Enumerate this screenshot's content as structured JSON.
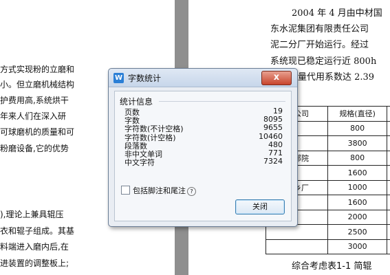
{
  "left_page": {
    "lines": [
      "方式实现粉的立磨和",
      "小。但立磨机械结构",
      "护费用高,系统烘干",
      "年来人们在深入研",
      "可球磨机的质量和可",
      "粉磨设备,它的优势",
      "),理论上兼具辊压",
      "衣和辊子组成。其基",
      "料端进入磨内后,在",
      "进装置的调整板上;"
    ]
  },
  "right_page": {
    "lines": [
      "2004 年 4 月由中材国",
      "东水泥集团有限责任公司",
      "泥二分厂开始运行。经过",
      "系统现已稳定运行近 800h",
      "能量代用系数达 2.39"
    ],
    "caption": "综合考虑表1-1 简辊"
  },
  "table": {
    "headers": [
      "公司",
      "规格(直径)"
    ],
    "rows": [
      [
        "",
        "800"
      ],
      [
        "",
        "3800"
      ],
      [
        "部院",
        "800"
      ],
      [
        "",
        "1600"
      ],
      [
        "乡厂",
        "1000"
      ],
      [
        "",
        "1600"
      ],
      [
        "",
        "2000"
      ],
      [
        "",
        "2500"
      ],
      [
        "",
        "3000"
      ]
    ]
  },
  "dialog": {
    "app_icon": "W",
    "title": "字数统计",
    "close_glyph": "x",
    "group_label": "统计信息",
    "stats": [
      {
        "label": "页数",
        "value": "19"
      },
      {
        "label": "字数",
        "value": "8095"
      },
      {
        "label": "字符数(不计空格)",
        "value": "9655"
      },
      {
        "label": "字符数(计空格)",
        "value": "10460"
      },
      {
        "label": "段落数",
        "value": "480"
      },
      {
        "label": "非中文单词",
        "value": "771"
      },
      {
        "label": "中文字符",
        "value": "7324"
      }
    ],
    "checkbox_label": "包括脚注和尾注",
    "help_glyph": "?",
    "checkbox_checked": false,
    "button_label": "关闭"
  }
}
